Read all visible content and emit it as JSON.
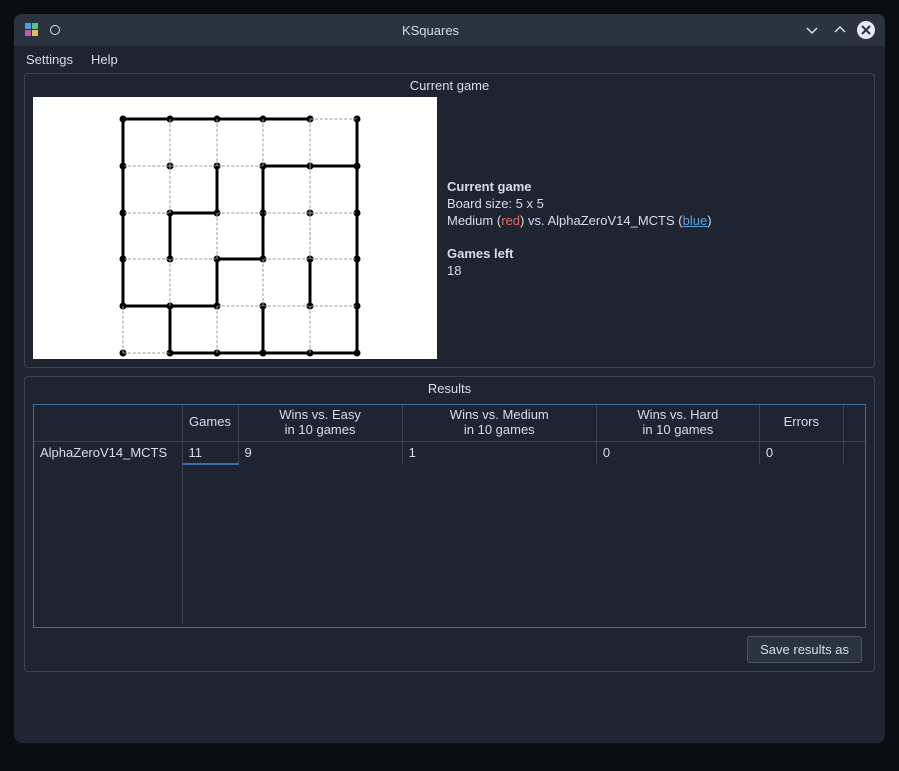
{
  "window": {
    "title": "KSquares"
  },
  "menubar": {
    "settings": "Settings",
    "help": "Help"
  },
  "current_game": {
    "panel_title": "Current game",
    "heading": "Current game",
    "board_size_label": "Board size: 5 x 5",
    "p1_label": "Medium",
    "p1_color_word": "red",
    "vs": "vs.",
    "p2_label": "AlphaZeroV14_MCTS",
    "p2_color_word": "blue",
    "games_left_heading": "Games left",
    "games_left_value": "18"
  },
  "results": {
    "panel_title": "Results",
    "columns": {
      "games": "Games",
      "easy_l1": "Wins vs. Easy",
      "easy_l2": "in 10 games",
      "medium_l1": "Wins vs. Medium",
      "medium_l2": "in 10 games",
      "hard_l1": "Wins vs. Hard",
      "hard_l2": "in 10 games",
      "errors": "Errors"
    },
    "rows": [
      {
        "name": "AlphaZeroV14_MCTS",
        "games": "11",
        "wins_easy": "9",
        "wins_medium": "1",
        "wins_hard": "0",
        "errors": "0"
      }
    ],
    "save_button": "Save results as"
  },
  "board": {
    "size": 5,
    "h_edges": [
      [
        1,
        1,
        1,
        1,
        0
      ],
      [
        0,
        0,
        0,
        1,
        1
      ],
      [
        0,
        1,
        0,
        0,
        0
      ],
      [
        0,
        0,
        1,
        0,
        0
      ],
      [
        1,
        1,
        0,
        0,
        0
      ],
      [
        0,
        1,
        1,
        1,
        1
      ]
    ],
    "v_edges": [
      [
        1,
        0,
        0,
        0,
        0,
        1
      ],
      [
        1,
        0,
        1,
        1,
        0,
        1
      ],
      [
        1,
        1,
        0,
        1,
        0,
        1
      ],
      [
        1,
        0,
        1,
        0,
        1,
        1
      ],
      [
        0,
        1,
        0,
        1,
        0,
        1
      ]
    ]
  }
}
